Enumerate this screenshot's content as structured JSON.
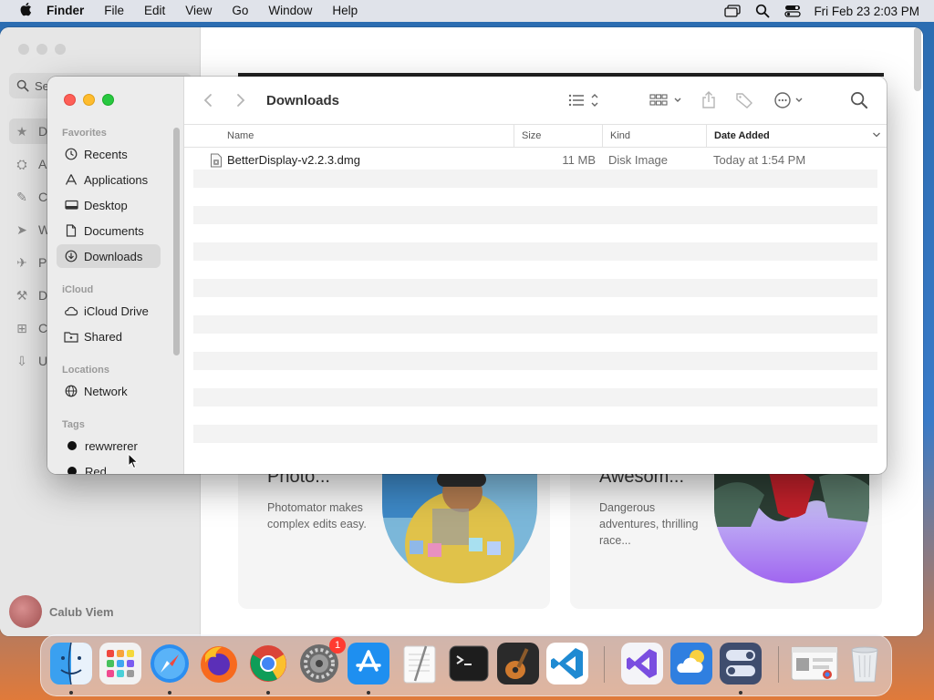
{
  "menubar": {
    "app_name": "Finder",
    "menus": [
      "File",
      "Edit",
      "View",
      "Go",
      "Window",
      "Help"
    ],
    "clock": "Fri Feb 23  2:03 PM"
  },
  "background_app": {
    "search_placeholder": "Search",
    "nav_initials": [
      "D",
      "A",
      "C",
      "W",
      "P",
      "D",
      "C",
      "U"
    ],
    "user_name": "Calub Viem",
    "cards": [
      {
        "title": "Photo...",
        "subtitle": "Photomator makes complex edits easy."
      },
      {
        "title": "Awesom...",
        "subtitle": "Dangerous adventures, thrilling race..."
      }
    ]
  },
  "finder": {
    "title": "Downloads",
    "sidebar": {
      "favorites_header": "Favorites",
      "favorites": [
        {
          "label": "Recents",
          "icon": "clock-icon"
        },
        {
          "label": "Applications",
          "icon": "applications-icon"
        },
        {
          "label": "Desktop",
          "icon": "desktop-icon"
        },
        {
          "label": "Documents",
          "icon": "document-icon"
        },
        {
          "label": "Downloads",
          "icon": "download-icon",
          "selected": true
        }
      ],
      "icloud_header": "iCloud",
      "icloud": [
        {
          "label": "iCloud Drive",
          "icon": "cloud-icon"
        },
        {
          "label": "Shared",
          "icon": "shared-folder-icon"
        }
      ],
      "locations_header": "Locations",
      "locations": [
        {
          "label": "Network",
          "icon": "globe-icon"
        }
      ],
      "tags_header": "Tags",
      "tags": [
        {
          "label": "rewwrerer",
          "color": "#111111"
        },
        {
          "label": "Red",
          "color": "#111111"
        }
      ]
    },
    "columns": {
      "name": "Name",
      "size": "Size",
      "kind": "Kind",
      "date_added": "Date Added"
    },
    "files": [
      {
        "name": "BetterDisplay-v2.2.3.dmg",
        "size": "11 MB",
        "kind": "Disk Image",
        "date_added": "Today at 1:54 PM",
        "icon": "disk-image-icon"
      }
    ]
  },
  "dock": {
    "apps": [
      "Finder",
      "Launchpad",
      "Safari",
      "Firefox",
      "Chrome",
      "System Settings",
      "App Store",
      "TextEdit",
      "Terminal",
      "GarageBand",
      "Visual Studio Code",
      "Visual Studio",
      "Weather",
      "Control Center",
      "Recent Window",
      "Trash"
    ],
    "system_settings_badge": "1"
  }
}
